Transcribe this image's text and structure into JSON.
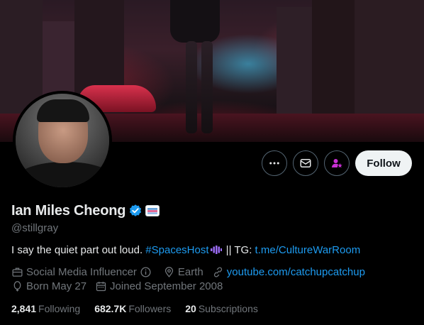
{
  "profile": {
    "name": "Ian Miles Cheong",
    "handle": "@stillgray",
    "bio": {
      "text_before": "I say the quiet part out loud. ",
      "hashtag": "#SpacesHost",
      "text_middle": " || TG: ",
      "tg_link": "t.me/CultureWarRoom"
    },
    "category": "Social Media Influencer",
    "location": "Earth",
    "website": "youtube.com/catchupcatchup",
    "birthday": "Born May 27",
    "joined": "Joined September 2008"
  },
  "stats": {
    "following_count": "2,841",
    "following_label": "Following",
    "followers_count": "682.7K",
    "followers_label": "Followers",
    "subscriptions_count": "20",
    "subscriptions_label": "Subscriptions"
  },
  "actions": {
    "follow_label": "Follow",
    "more_icon": "more-icon",
    "message_icon": "mail-icon",
    "subscribe_icon": "subscribe-icon"
  },
  "colors": {
    "background": "#000000",
    "link": "#1d9bf0",
    "verified": "#1d9bf0",
    "subscribe_accent": "#c930d5",
    "muted_text": "#71767b"
  }
}
